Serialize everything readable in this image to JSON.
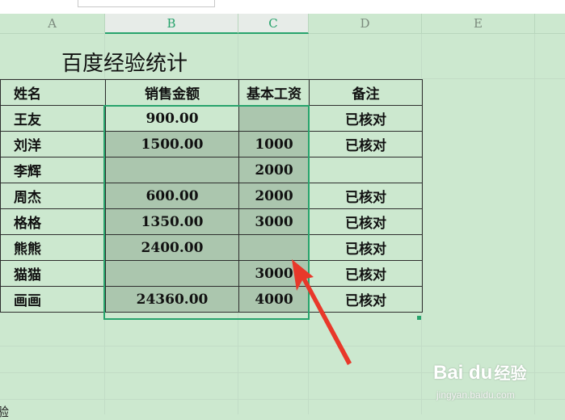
{
  "columns": [
    {
      "letter": "A"
    },
    {
      "letter": "B"
    },
    {
      "letter": "C"
    },
    {
      "letter": "D"
    },
    {
      "letter": "E"
    }
  ],
  "sheet_title": "百度经验统计",
  "headers": [
    "姓名",
    "销售金额",
    "基本工资",
    "备注"
  ],
  "rows": [
    {
      "name": "王友",
      "sales": "900.00",
      "salary": "",
      "note": "已核对"
    },
    {
      "name": "刘洋",
      "sales": "1500.00",
      "salary": "1000",
      "note": "已核对"
    },
    {
      "name": "李辉",
      "sales": "",
      "salary": "2000",
      "note": ""
    },
    {
      "name": "周杰",
      "sales": "600.00",
      "salary": "2000",
      "note": "已核对"
    },
    {
      "name": "格格",
      "sales": "1350.00",
      "salary": "3000",
      "note": "已核对"
    },
    {
      "name": "熊熊",
      "sales": "2400.00",
      "salary": "",
      "note": "已核对"
    },
    {
      "name": "猫猫",
      "sales": "",
      "salary": "3000",
      "note": "已核对"
    },
    {
      "name": "画画",
      "sales": "24360.00",
      "salary": "4000",
      "note": "已核对"
    }
  ],
  "bottom_text": "验",
  "watermark": {
    "logo": "Bai du",
    "cn": "经验",
    "url": "jingyan.baidu.com"
  },
  "colors": {
    "background": "#cce8cf",
    "selection": "#27a36c",
    "selected_fill": "#abc6ae",
    "arrow": "#e8382a"
  }
}
